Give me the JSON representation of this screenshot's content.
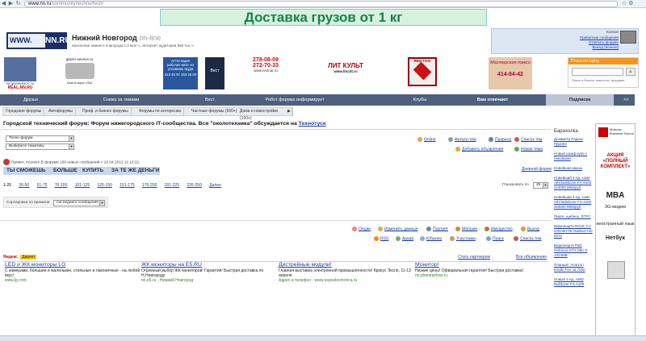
{
  "browser": {
    "url_host": "www.nn.ru",
    "url_path": "/community/techno/tech/"
  },
  "banner": {
    "text": "Доставка грузов от 1 кг"
  },
  "header": {
    "logo_www": "WWW.",
    "logo_nn": "NN.RU",
    "title": "Нижний Новгород",
    "title_suffix": "on-line",
    "subtitle": "население нижнего новгорода 1,3 млн ч., интернет аудитория 869 тыс.ч.",
    "login_name": "Ксенон",
    "login_links": [
      "Приватные сообщения",
      "Ответить форуме",
      "Выход (Ксенон)"
    ]
  },
  "sponsors": [
    {
      "label": "REAL.NN.RU",
      "sub": "НЕДВИЖИМОСТЬ"
    },
    {
      "label": "glazer-service.ru",
      "sub": "Asia Europe USA"
    },
    {
      "label": "Аттестация рабочих мест по условиям труда",
      "sub": "413 45 97 253 25 00"
    },
    {
      "label": "Вест",
      "sub": ""
    },
    {
      "label": "278-08-09",
      "sub": "272-70-33",
      "extra": "www.nn4car.ru"
    },
    {
      "label": "ЛИТ КУЛЬТ",
      "sub": "www.litcult.ru"
    },
    {
      "label": "RED TAXI",
      "sub": ""
    },
    {
      "label": "Мастерская такси",
      "sub": "414-84-42"
    }
  ],
  "search": {
    "header": "Поиск по сайту",
    "hint": "Поиск в блогах, новостях, форумах"
  },
  "nav": {
    "items": [
      "Друзья",
      "Снижу за темами",
      "Вест",
      "Робот форума информирует",
      "Клубы",
      "Вам отвечают",
      "Подписка",
      "<<"
    ]
  },
  "subnav": {
    "items": [
      "Городские форумы",
      "Автофорумы",
      "Проф. и бизнес форумы",
      "Форумы по интересам",
      "Частные форумы (500+)",
      "Дома и новостройки (100+)",
      "▶"
    ]
  },
  "page": {
    "title": "Городской технический форум: Форум нижегородского IT-сообщества. Вся \"околотехника\" обсуждается на ",
    "title_link": "Технотусе"
  },
  "filters": {
    "forum_select": "Техно-форум",
    "theme_select": "Выберите тематику"
  },
  "toplinks": {
    "online": "Online",
    "filter": "Фильтр тем",
    "rules": "Правила",
    "themes_list": "Список тем",
    "add_ad": "Добавить объявление",
    "new_theme": "Новая тема"
  },
  "prompt": "Привет, Ксенон! В форуме 150 новых сообщений с 10.04.2012 11:14:22",
  "quick": [
    "ТЫ СМОЖЕШЬ",
    "БОЛЬШЕ",
    "КУПИТЬ",
    "ЗА ТЕ ЖЕ ДЕНЬГИ"
  ],
  "daily_forum": "Дневной форум",
  "pages": [
    "1-25",
    "26-50",
    "51-75",
    "76-100",
    "101-125",
    "126-150",
    "151-175",
    "176-200",
    "201-225",
    "226-250",
    "Далее"
  ],
  "per_page_label": "Показывать по",
  "per_page_value": "25",
  "sort": {
    "label": "Сортировка по времени",
    "value": "последнего сообщения"
  },
  "bottom_links": {
    "row1": [
      "Опции",
      "Изменить данные",
      "Портрет",
      "Магазин",
      "Имущество",
      "Выход"
    ],
    "row2": [
      "RSS",
      "Архив",
      "Юбилеи",
      "Участники",
      "Поиск",
      "Список тем"
    ]
  },
  "direct": {
    "yandex": "Яндекс",
    "label": "Директ",
    "right1": "Стать партнером",
    "right2": "Все объявления"
  },
  "ads": [
    {
      "title": "LED и ЖК мониторы LG",
      "text": "С камерами, большие и маленькие, стильные и лаконичные - на любой вкус!",
      "url": "www.lg.com"
    },
    {
      "title": "ЖК мониторы на E5.RU",
      "text": "Огромный выбор ЖК мониторов! Гарантия! Быстрая доставка по Н.Новгороду",
      "url": "nn.e5.ru · Нижний Новгород"
    },
    {
      "title": "Дистрейные модули!",
      "text": "Главная выставка электронной промышленности! Крокус Экспо, 11-13 апреля",
      "url": "Адрес и телефон · www.expoelectronica.ru"
    },
    {
      "title": "Монитор!",
      "text": "Низкие цены! Официальная гарантия! Быстрая доставка!",
      "url": "nn.planetashop.ru"
    }
  ],
  "sidebar": {
    "header": "Барахолка",
    "entries": [
      "Дозиметр Радекс РД1503",
      "Новый шкаф-купе с боковыми",
      "Новейшая мышь",
      "Новейший 4-яд. комп Athl Bulldozer FX-8100 3x3000 8800руб",
      "Новейший 4-яд. комп Athl Bulldozer FX-4100 3x3600 8800руб",
      "Пиксе, щибень, DTFC",
      "Видеокарта RGLE 2-1 GIGABYTE Radeon HD 6570",
      "Видеокарта Palit GeForce GTX 550 Ti 1024MB",
      "Планшет Amazon Kindle Fire за 7000",
      "Новый 4-яд. AMD Bulldozer FX-4100"
    ]
  },
  "right_ad": {
    "school": "Moscow Business School",
    "action": "АКЦИЯ «ПОЛНЫЙ КОМПЛЕКТ»",
    "mba": "MBA",
    "modem": "3G-модем",
    "lang": "иностранный язык",
    "netbook": "Нетбук"
  }
}
